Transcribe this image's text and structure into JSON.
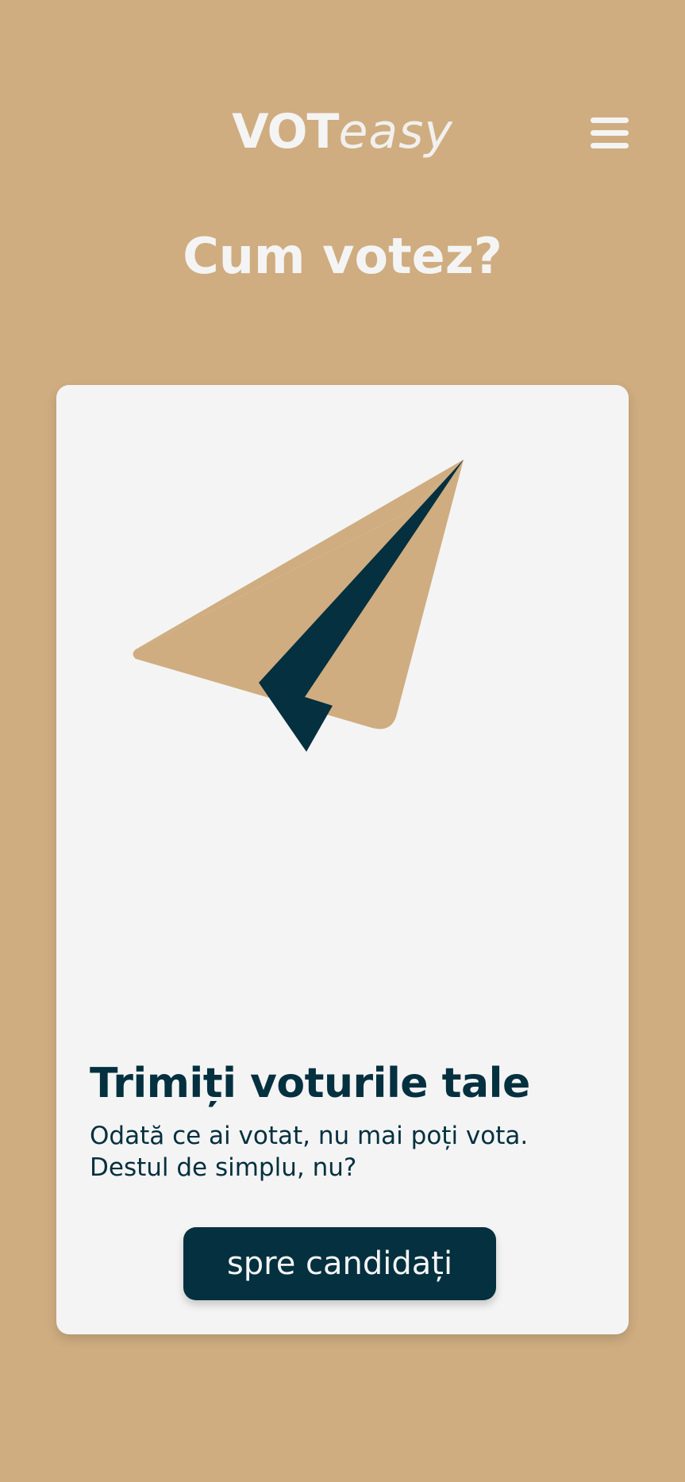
{
  "header": {
    "logo_bold": "VOT",
    "logo_light": "easy",
    "menu_icon": "hamburger-menu-icon"
  },
  "page": {
    "title": "Cum votez?"
  },
  "card": {
    "illustration_icon": "paper-plane-icon",
    "title": "Trimiți voturile tale",
    "description_line1": "Odată ce ai votat, nu mai poți vota.",
    "description_line2": "Destul de simplu, nu?",
    "button_label": "spre candidați"
  },
  "colors": {
    "background": "#CFAD80",
    "card": "#F4F4F4",
    "primary_dark": "#04303F",
    "light_text": "#F4F4F4"
  }
}
